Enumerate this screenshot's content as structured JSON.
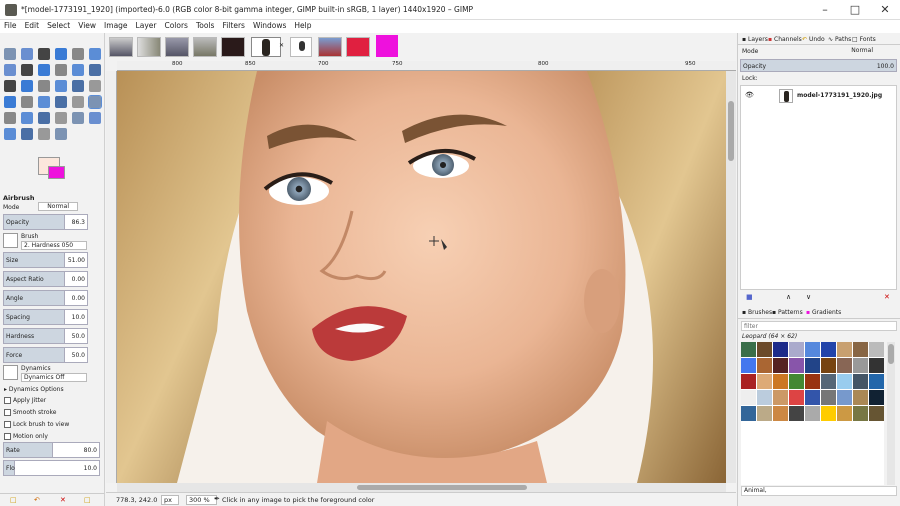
{
  "window": {
    "title": "*[model-1773191_1920] (imported)-6.0 (RGB color 8-bit gamma integer, GIMP built-in sRGB, 1 layer) 1440x1920 – GIMP"
  },
  "menu": [
    "File",
    "Edit",
    "Select",
    "View",
    "Image",
    "Layer",
    "Colors",
    "Tools",
    "Filters",
    "Windows",
    "Help"
  ],
  "colors": {
    "foreground": "#fce7dc",
    "background": "#ee11dd",
    "accent": "#5b8dd6"
  },
  "tool_options": {
    "title": "Airbrush",
    "mode_label": "Mode",
    "mode_value": "Normal",
    "opacity_label": "Opacity",
    "opacity_value": "86.3",
    "brush_label": "Brush",
    "brush_value": "2. Hardness 050",
    "sliders": [
      {
        "label": "Size",
        "value": "51.00"
      },
      {
        "label": "Aspect Ratio",
        "value": "0.00"
      },
      {
        "label": "Angle",
        "value": "0.00"
      },
      {
        "label": "Spacing",
        "value": "10.0"
      },
      {
        "label": "Hardness",
        "value": "50.0"
      },
      {
        "label": "Force",
        "value": "50.0"
      }
    ],
    "dynamics_label": "Dynamics",
    "dynamics_value": "Dynamics Off",
    "dynamics_options": "Dynamics Options",
    "checks": [
      "Apply Jitter",
      "Smooth stroke",
      "Lock brush to view",
      "Motion only"
    ],
    "rate_label": "Rate",
    "rate_value": "80.0",
    "flow_label": "Flow",
    "flow_value": "10.0"
  },
  "ruler_top": [
    "800",
    "850",
    "700",
    "750",
    "800",
    "950"
  ],
  "status": {
    "coords": "778.3, 242.0",
    "unit": "px",
    "zoom": "300 %",
    "message": "Click in any image to pick the foreground color"
  },
  "layers_panel": {
    "tabs": [
      "Layers",
      "Channels",
      "Undo",
      "Paths",
      "Fonts"
    ],
    "mode_label": "Mode",
    "mode_value": "Normal",
    "opacity_label": "Opacity",
    "opacity_value": "100.0",
    "lock_label": "Lock:",
    "layer_name": "model-1773191_1920.jpg"
  },
  "patterns_panel": {
    "tabs": [
      "Brushes",
      "Patterns",
      "Gradients"
    ],
    "filter_placeholder": "filter",
    "selected": "Leopard (64 × 62)",
    "tag": "Animal,"
  }
}
